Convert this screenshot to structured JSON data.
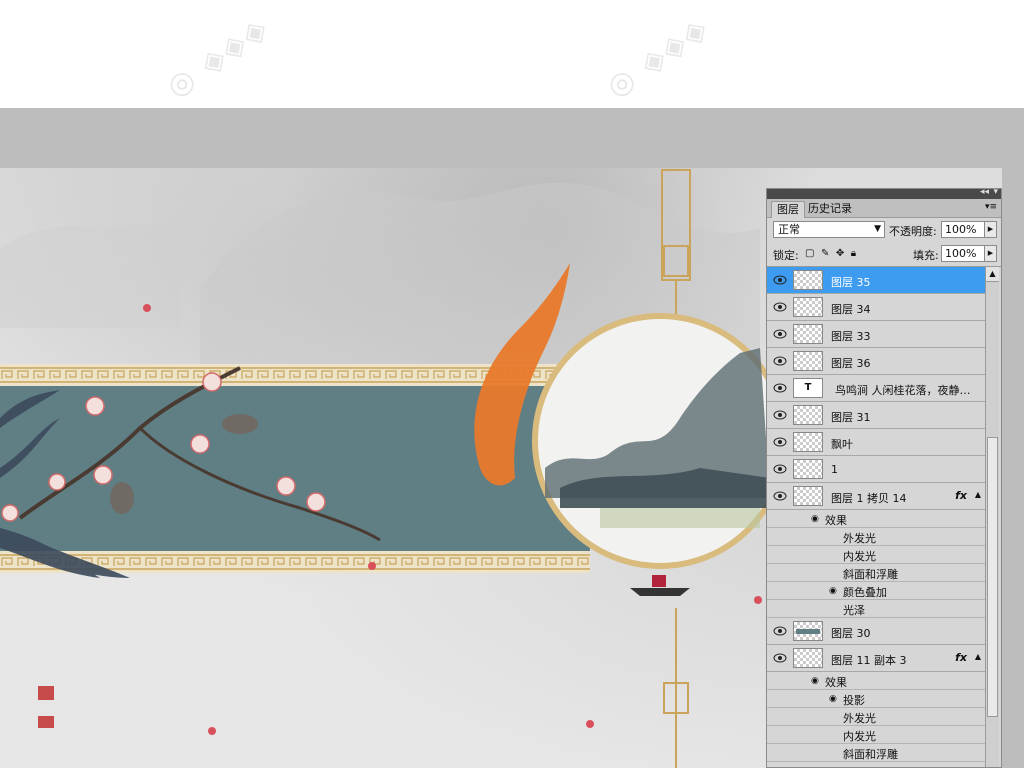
{
  "panel": {
    "title_icons": {
      "collapse": "◂◂",
      "close": "▾"
    },
    "tabs": [
      {
        "label": "图层",
        "active": true
      },
      {
        "label": "历史记录",
        "active": false
      }
    ],
    "menu_icon": "panel-menu-icon",
    "blend_mode": "正常",
    "opacity_label": "不透明度:",
    "opacity_value": "100%",
    "lock_label": "锁定:",
    "fill_label": "填充:",
    "fill_value": "100%",
    "layers": [
      {
        "name": "图层 35",
        "selected": true,
        "thumb": "transparent"
      },
      {
        "name": "图层 34",
        "selected": false,
        "thumb": "transparent"
      },
      {
        "name": "图层 33",
        "selected": false,
        "thumb": "transparent"
      },
      {
        "name": "图层 36",
        "selected": false,
        "thumb": "transparent"
      },
      {
        "name": "鸟鸣涧 人闲桂花落，夜静…",
        "selected": false,
        "thumb": "text",
        "thumb_label": "T"
      },
      {
        "name": "图层 31",
        "selected": false,
        "thumb": "transparent"
      },
      {
        "name": "飘叶",
        "selected": false,
        "thumb": "transparent"
      },
      {
        "name": "1",
        "selected": false,
        "thumb": "transparent"
      },
      {
        "name": "图层 1 拷贝 14",
        "selected": false,
        "thumb": "transparent",
        "fx": "fx"
      }
    ],
    "effects_group_1": {
      "label": "效果",
      "items": [
        "外发光",
        "内发光",
        "斜面和浮雕"
      ],
      "eye_item": "颜色叠加",
      "last_item": "光泽"
    },
    "layers_2": [
      {
        "name": "图层 30",
        "thumb": "teal"
      },
      {
        "name": "图层 11 副本 3",
        "thumb": "transparent",
        "fx": "fx"
      }
    ],
    "effects_group_2": {
      "label": "效果",
      "eye_item": "投影",
      "items": [
        "外发光",
        "内发光",
        "斜面和浮雕"
      ]
    }
  },
  "colors": {
    "workspace": "#bdbdbd",
    "banner": "#607f85",
    "selected_layer": "#3d9bf0",
    "gold": "#c9a45a",
    "koi": "#e8792b"
  }
}
